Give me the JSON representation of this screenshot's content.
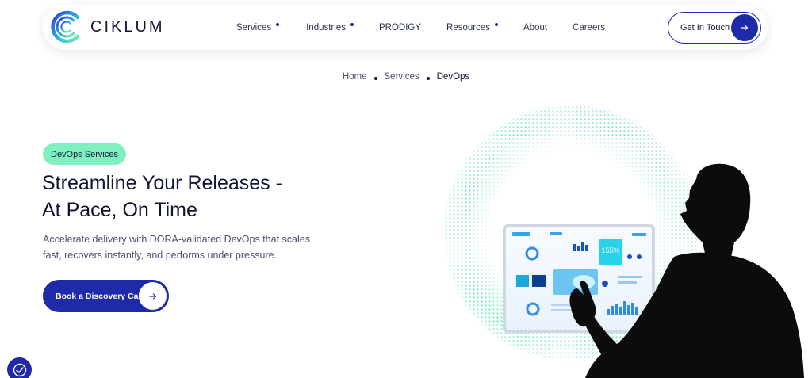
{
  "brand": {
    "name": "CIKLUM"
  },
  "nav": {
    "items": [
      {
        "label": "Services",
        "has_dot": true
      },
      {
        "label": "Industries",
        "has_dot": true
      },
      {
        "label": "PRODIGY",
        "has_dot": false
      },
      {
        "label": "Resources",
        "has_dot": true
      },
      {
        "label": "About",
        "has_dot": false
      },
      {
        "label": "Careers",
        "has_dot": false
      }
    ],
    "cta_label": "Get In Touch",
    "cta_icon": "arrow-right-icon"
  },
  "breadcrumb": [
    "Home",
    "Services",
    "DevOps"
  ],
  "hero": {
    "badge": "DevOps Services",
    "headline_line1": "Streamline Your Releases -",
    "headline_line2": "At Pace, On Time",
    "subtext": "Accelerate delivery with DORA-validated DevOps that scales fast, recovers instantly, and performs under pressure.",
    "button_label": "Book a Discovery Call",
    "button_icon": "arrow-right-icon",
    "screen_stat": "155%"
  },
  "colors": {
    "primary": "#1f2aa8",
    "mint": "#7ff0c0",
    "text_dark": "#0f1535",
    "text_muted": "#4a5070"
  },
  "accessibility": {
    "icon": "accessibility-icon"
  }
}
